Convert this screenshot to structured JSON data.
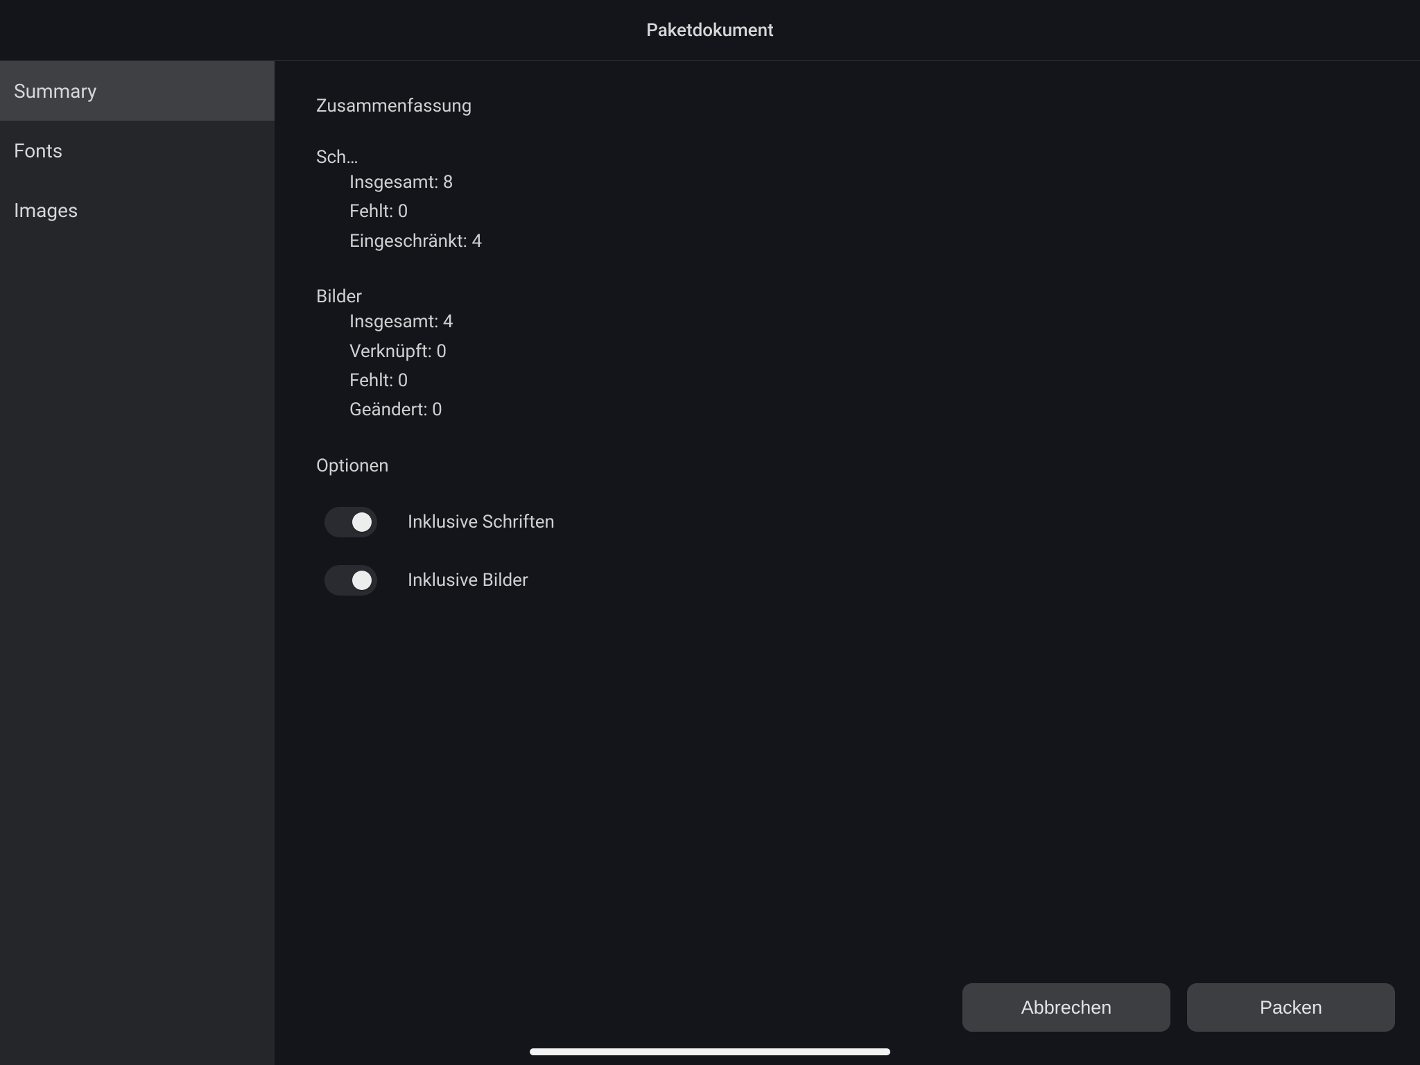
{
  "title": "Paketdokument",
  "sidebar": {
    "items": [
      {
        "label": "Summary"
      },
      {
        "label": "Fonts"
      },
      {
        "label": "Images"
      }
    ]
  },
  "summary": {
    "heading": "Zusammenfassung",
    "fonts": {
      "title": "Sch…",
      "total_label": "Insgesamt:",
      "total_value": "8",
      "missing_label": "Fehlt:",
      "missing_value": "0",
      "restricted_label": "Eingeschränkt:",
      "restricted_value": "4"
    },
    "images": {
      "title": "Bilder",
      "total_label": "Insgesamt:",
      "total_value": "4",
      "linked_label": "Verknüpft:",
      "linked_value": "0",
      "missing_label": "Fehlt:",
      "missing_value": "0",
      "changed_label": "Geändert:",
      "changed_value": "0"
    },
    "options": {
      "heading": "Optionen",
      "include_fonts_label": "Inklusive Schriften",
      "include_images_label": "Inklusive Bilder"
    }
  },
  "buttons": {
    "cancel": "Abbrechen",
    "package": "Packen"
  }
}
